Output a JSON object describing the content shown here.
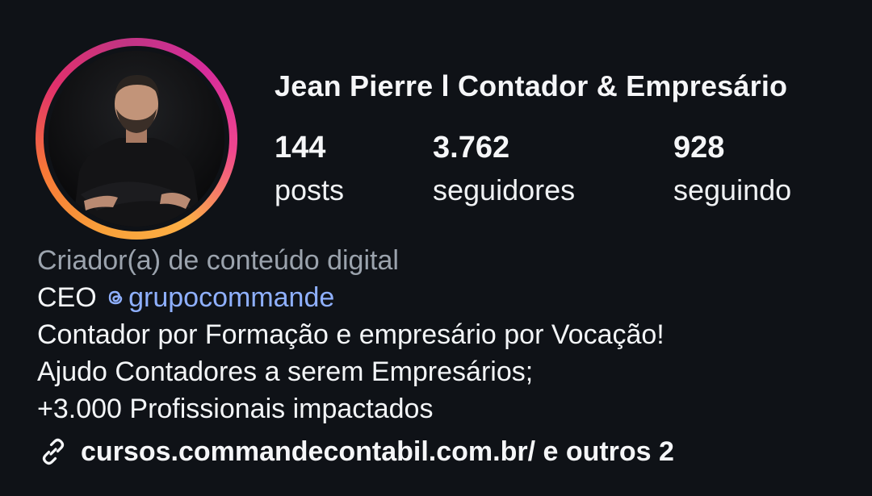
{
  "profile": {
    "username": "Jean Pierre l Contador & Empresário",
    "avatar_alt": "",
    "stats": {
      "posts": {
        "value": "144",
        "label": "posts"
      },
      "followers": {
        "value": "3.762",
        "label": "seguidores"
      },
      "following": {
        "value": "928",
        "label": "seguindo"
      }
    },
    "bio": {
      "category": "Criador(a) de conteúdo digital",
      "line1_prefix": "CEO ",
      "mention": "grupocommande",
      "line2": "Contador por Formação e empresário por Vocação!",
      "line3": "Ajudo Contadores a serem Empresários;",
      "line4": "+3.000 Profissionais impactados"
    },
    "link": {
      "icon": "link-icon",
      "text": "cursos.commandecontabil.com.br/ e outros 2"
    }
  },
  "colors": {
    "background": "#0f1217",
    "text": "#f5f6f8",
    "muted": "#9ba3ad",
    "mention": "#8fb0ff",
    "ring_gradient": [
      "#f9a13a",
      "#f77737",
      "#e1306c",
      "#c13584"
    ]
  }
}
